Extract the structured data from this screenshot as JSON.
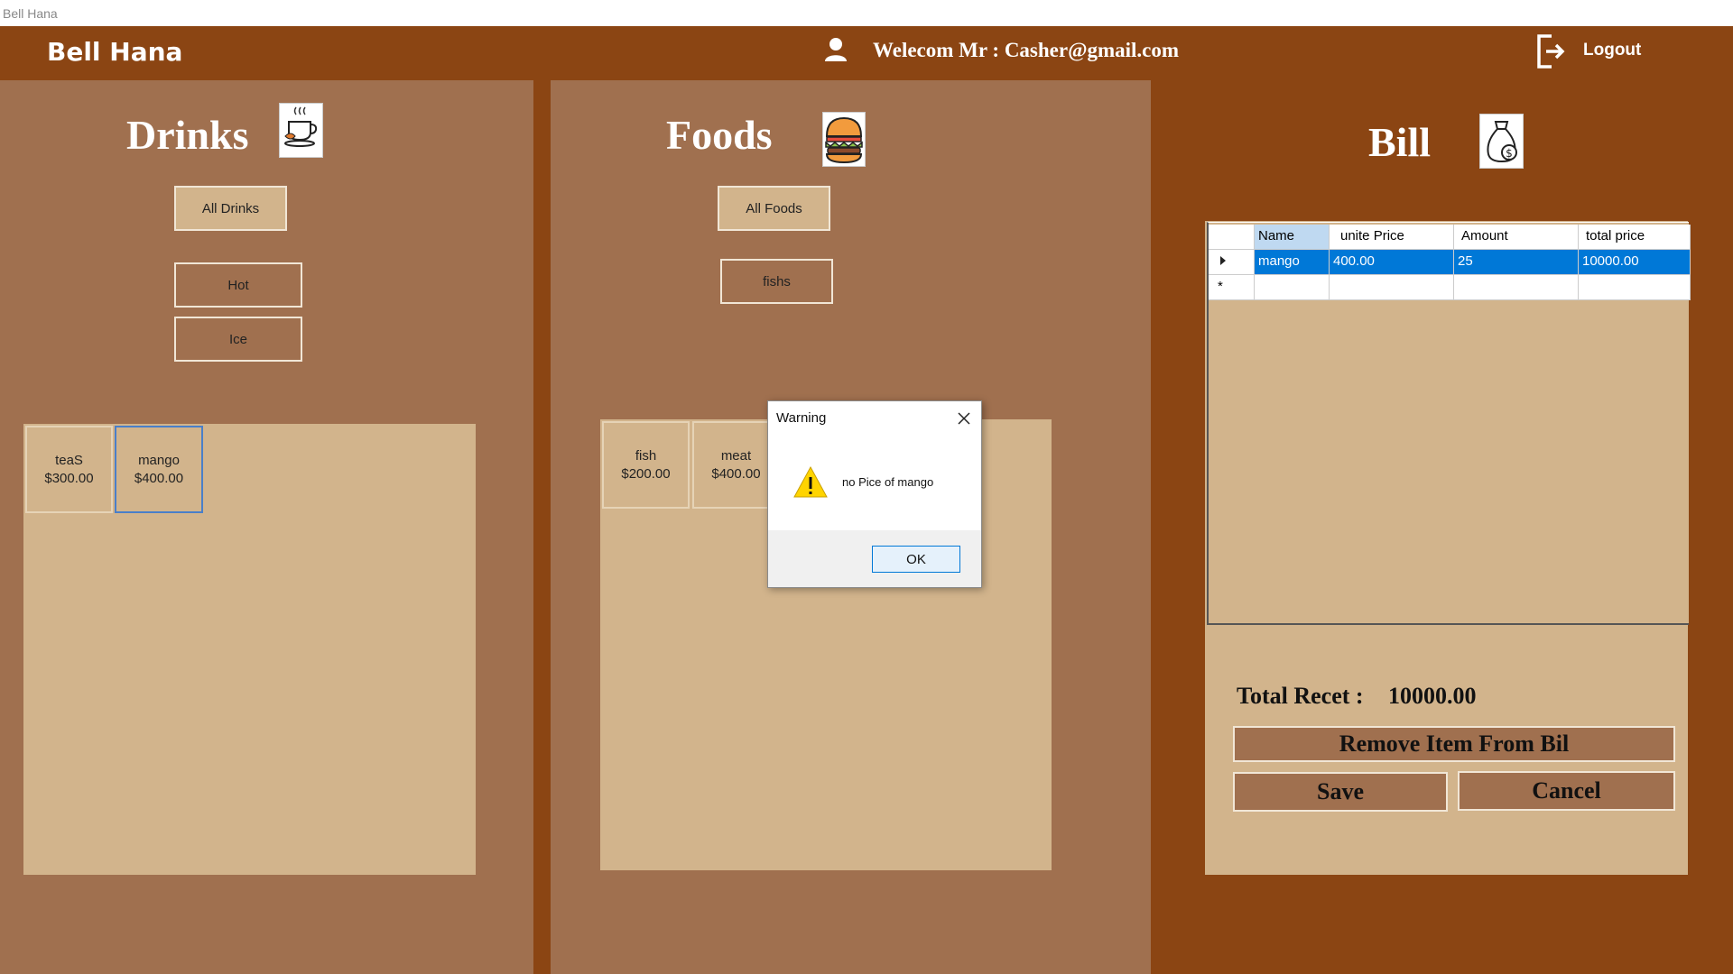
{
  "window": {
    "title": "Bell Hana"
  },
  "header": {
    "app_name": "Bell Hana",
    "welcome": "Welecom Mr : Casher@gmail.com",
    "logout_label": "Logout"
  },
  "drinks": {
    "title": "Drinks",
    "icon": "coffee-cup-icon",
    "categories": [
      "All Drinks",
      "Hot",
      "Ice"
    ],
    "items": [
      {
        "name": "teaS",
        "price": "$300.00"
      },
      {
        "name": "mango",
        "price": "$400.00"
      }
    ]
  },
  "foods": {
    "title": "Foods",
    "icon": "burger-icon",
    "categories": [
      "All Foods",
      "fishs"
    ],
    "items": [
      {
        "name": "fish",
        "price": "$200.00"
      },
      {
        "name": "meat",
        "price": "$400.00"
      }
    ]
  },
  "bill": {
    "title": "Bill",
    "icon": "money-bag-icon",
    "columns": [
      "Name",
      "unite Price",
      "Amount",
      "total price"
    ],
    "rows": [
      {
        "name": "mango",
        "unit_price": "400.00",
        "amount": "25",
        "total": "10000.00"
      }
    ],
    "new_row_marker": "*",
    "total_label": "Total Recet :",
    "total_value": "10000.00",
    "remove_label": "Remove Item From Bil",
    "save_label": "Save",
    "cancel_label": "Cancel"
  },
  "dialog": {
    "title": "Warning",
    "message": "no Pice of mango",
    "ok_label": "OK",
    "icon": "warning-icon"
  },
  "colors": {
    "header_bg": "#8B4513",
    "panel_bg": "#A0704F",
    "tile_bg": "#D2B48C",
    "selected_row": "#0078D7"
  }
}
